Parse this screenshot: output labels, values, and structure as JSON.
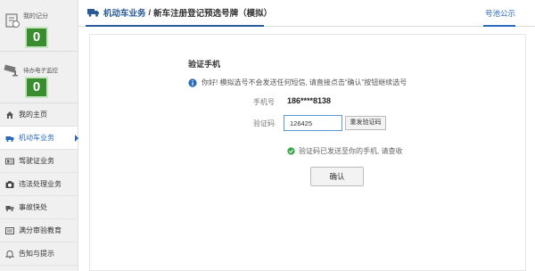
{
  "sidebar": {
    "score": {
      "label": "我的记分",
      "value": "0",
      "icon": "scorecard-icon"
    },
    "monitor": {
      "label": "待办电子监控",
      "value": "0",
      "icon": "camera-icon"
    },
    "items": [
      {
        "label": "我的主页",
        "icon": "home-icon",
        "active": false
      },
      {
        "label": "机动车业务",
        "icon": "car-icon",
        "active": true
      },
      {
        "label": "驾驶证业务",
        "icon": "license-icon",
        "active": false
      },
      {
        "label": "违法处理业务",
        "icon": "camera-icon",
        "active": false
      },
      {
        "label": "事故快处",
        "icon": "accident-icon",
        "active": false
      },
      {
        "label": "满分审验教育",
        "icon": "document-icon",
        "active": false
      },
      {
        "label": "告知与提示",
        "icon": "bell-icon",
        "active": false
      }
    ]
  },
  "header": {
    "section": "机动车业务",
    "separator": "/",
    "subtitle": "新车注册登记预选号牌（模拟）",
    "notice_link": "号池公示"
  },
  "main": {
    "title": "验证手机",
    "info": "你好! 模拟选号不会发送任何短信, 请直接点击“确认”按钮继续选号",
    "phone_label": "手机号",
    "phone_value": "186****8138",
    "code_label": "验证码",
    "code_value": "126425",
    "resend_label": "重发验证码",
    "success_text": "验证码已发送至你的手机, 请查收",
    "confirm_label": "确认"
  },
  "colors": {
    "accent": "#2a5a96",
    "score_green": "#3a8d2f",
    "info_blue": "#2a6ab8",
    "success_green": "#3aa64a"
  }
}
